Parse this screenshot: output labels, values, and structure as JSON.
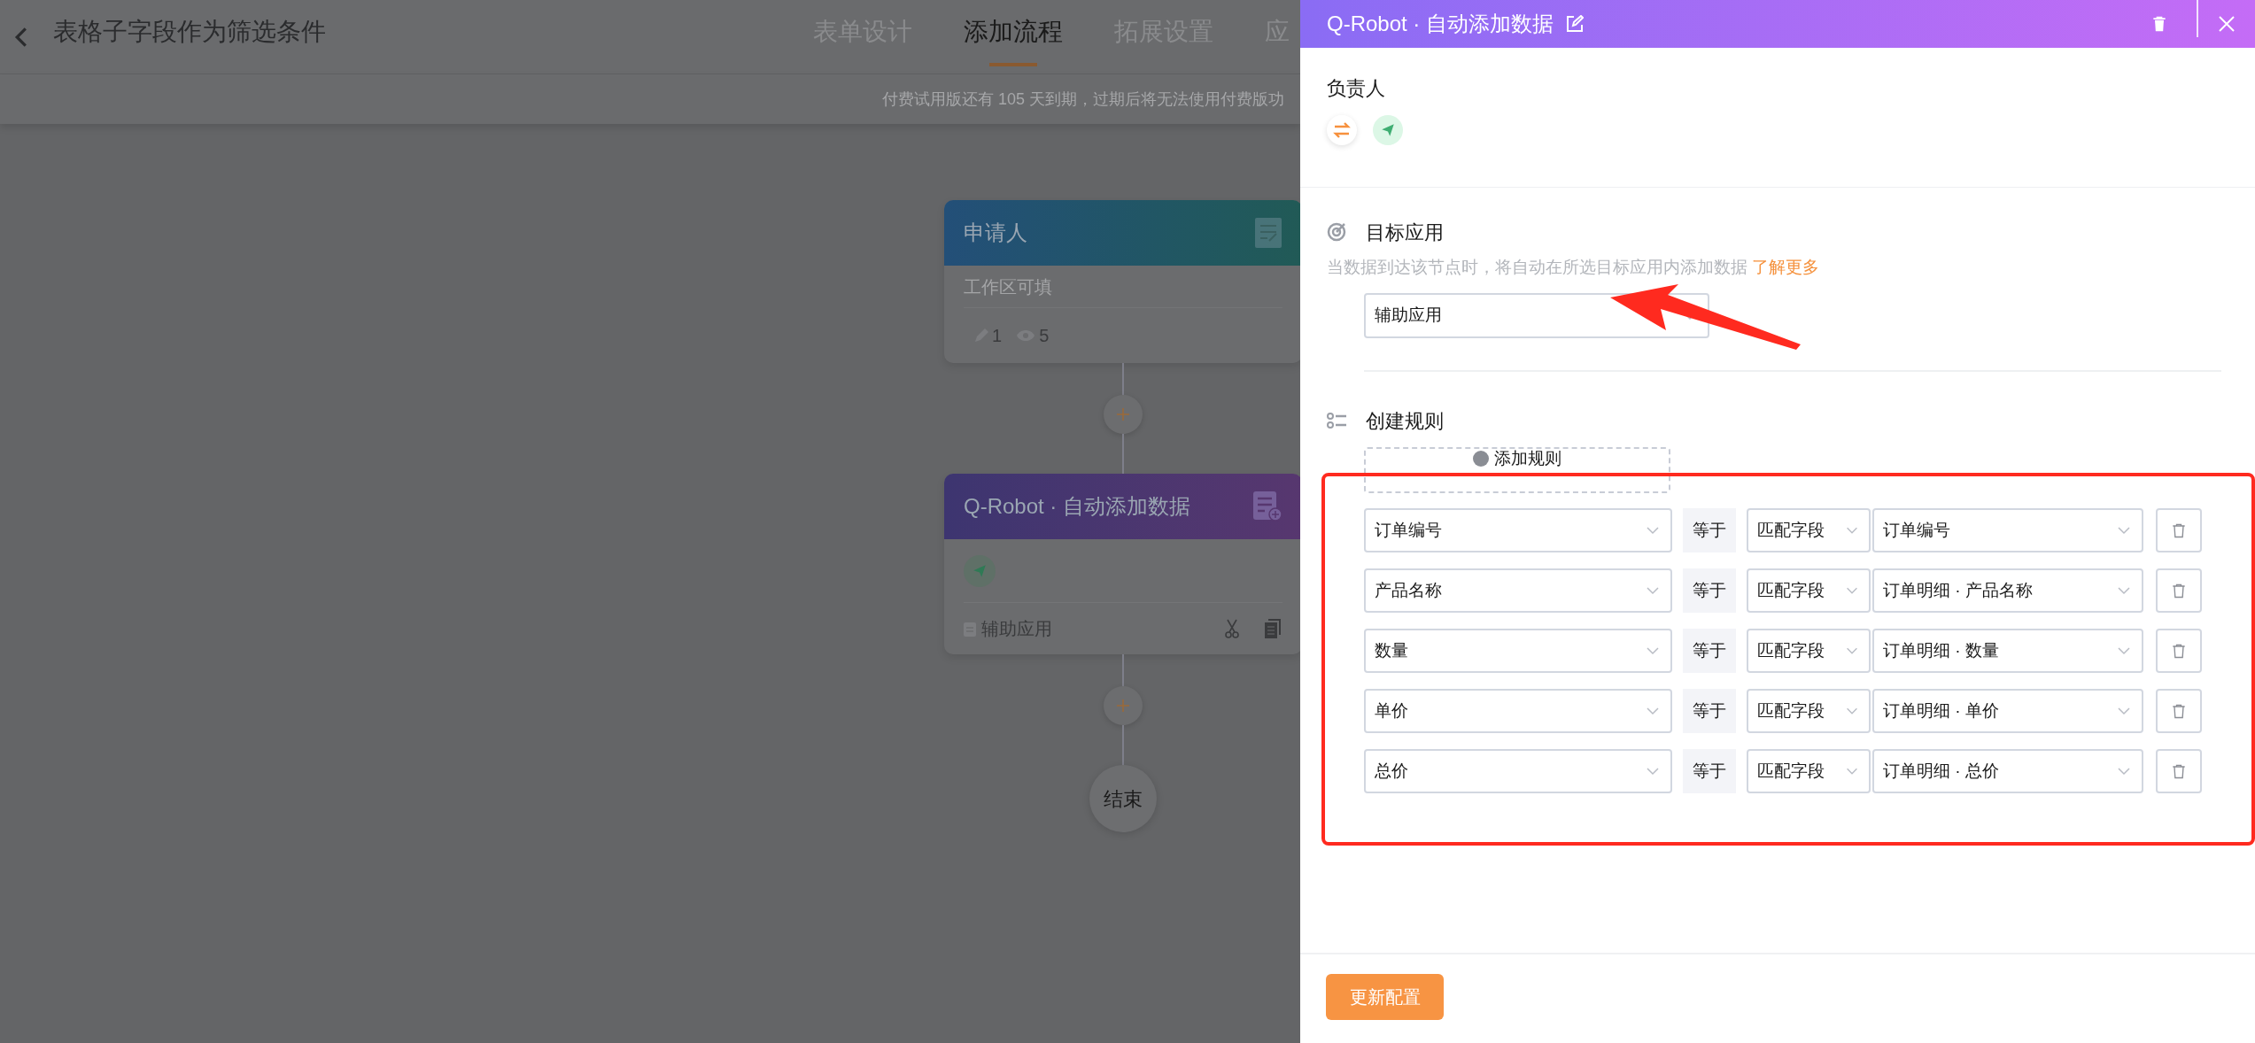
{
  "header": {
    "title": "表格子字段作为筛选条件",
    "tabs": [
      {
        "label": "表单设计",
        "selected": false
      },
      {
        "label": "添加流程",
        "selected": true
      },
      {
        "label": "拓展设置",
        "selected": false
      },
      {
        "label": "应",
        "selected": false
      }
    ],
    "notice": "付费试用版还有 105 天到期，过期后将无法使用付费版功"
  },
  "flow": {
    "nodes": [
      {
        "kind": "start",
        "title": "申请人",
        "subtitle": "工作区可填",
        "edit_count": "1",
        "view_count": "5"
      },
      {
        "kind": "robot",
        "title": "Q-Robot · 自动添加数据",
        "app": "辅助应用"
      }
    ],
    "end": "结束"
  },
  "panel": {
    "title": "Q-Robot · 自动添加数据",
    "owner_label": "负责人",
    "target": {
      "heading": "目标应用",
      "description": "当数据到达该节点时，将自动在所选目标应用内添加数据",
      "link": "了解更多",
      "selected_app": "辅助应用"
    },
    "rules": {
      "heading": "创建规则",
      "add_button": "添加规则",
      "items": [
        {
          "field": "订单编号",
          "operator": "等于",
          "mode": "匹配字段",
          "value": "订单编号"
        },
        {
          "field": "产品名称",
          "operator": "等于",
          "mode": "匹配字段",
          "value": "订单明细 · 产品名称"
        },
        {
          "field": "数量",
          "operator": "等于",
          "mode": "匹配字段",
          "value": "订单明细 · 数量"
        },
        {
          "field": "单价",
          "operator": "等于",
          "mode": "匹配字段",
          "value": "订单明细 · 单价"
        },
        {
          "field": "总价",
          "operator": "等于",
          "mode": "匹配字段",
          "value": "订单明细 · 总价"
        }
      ]
    },
    "submit_button": "更新配置"
  }
}
